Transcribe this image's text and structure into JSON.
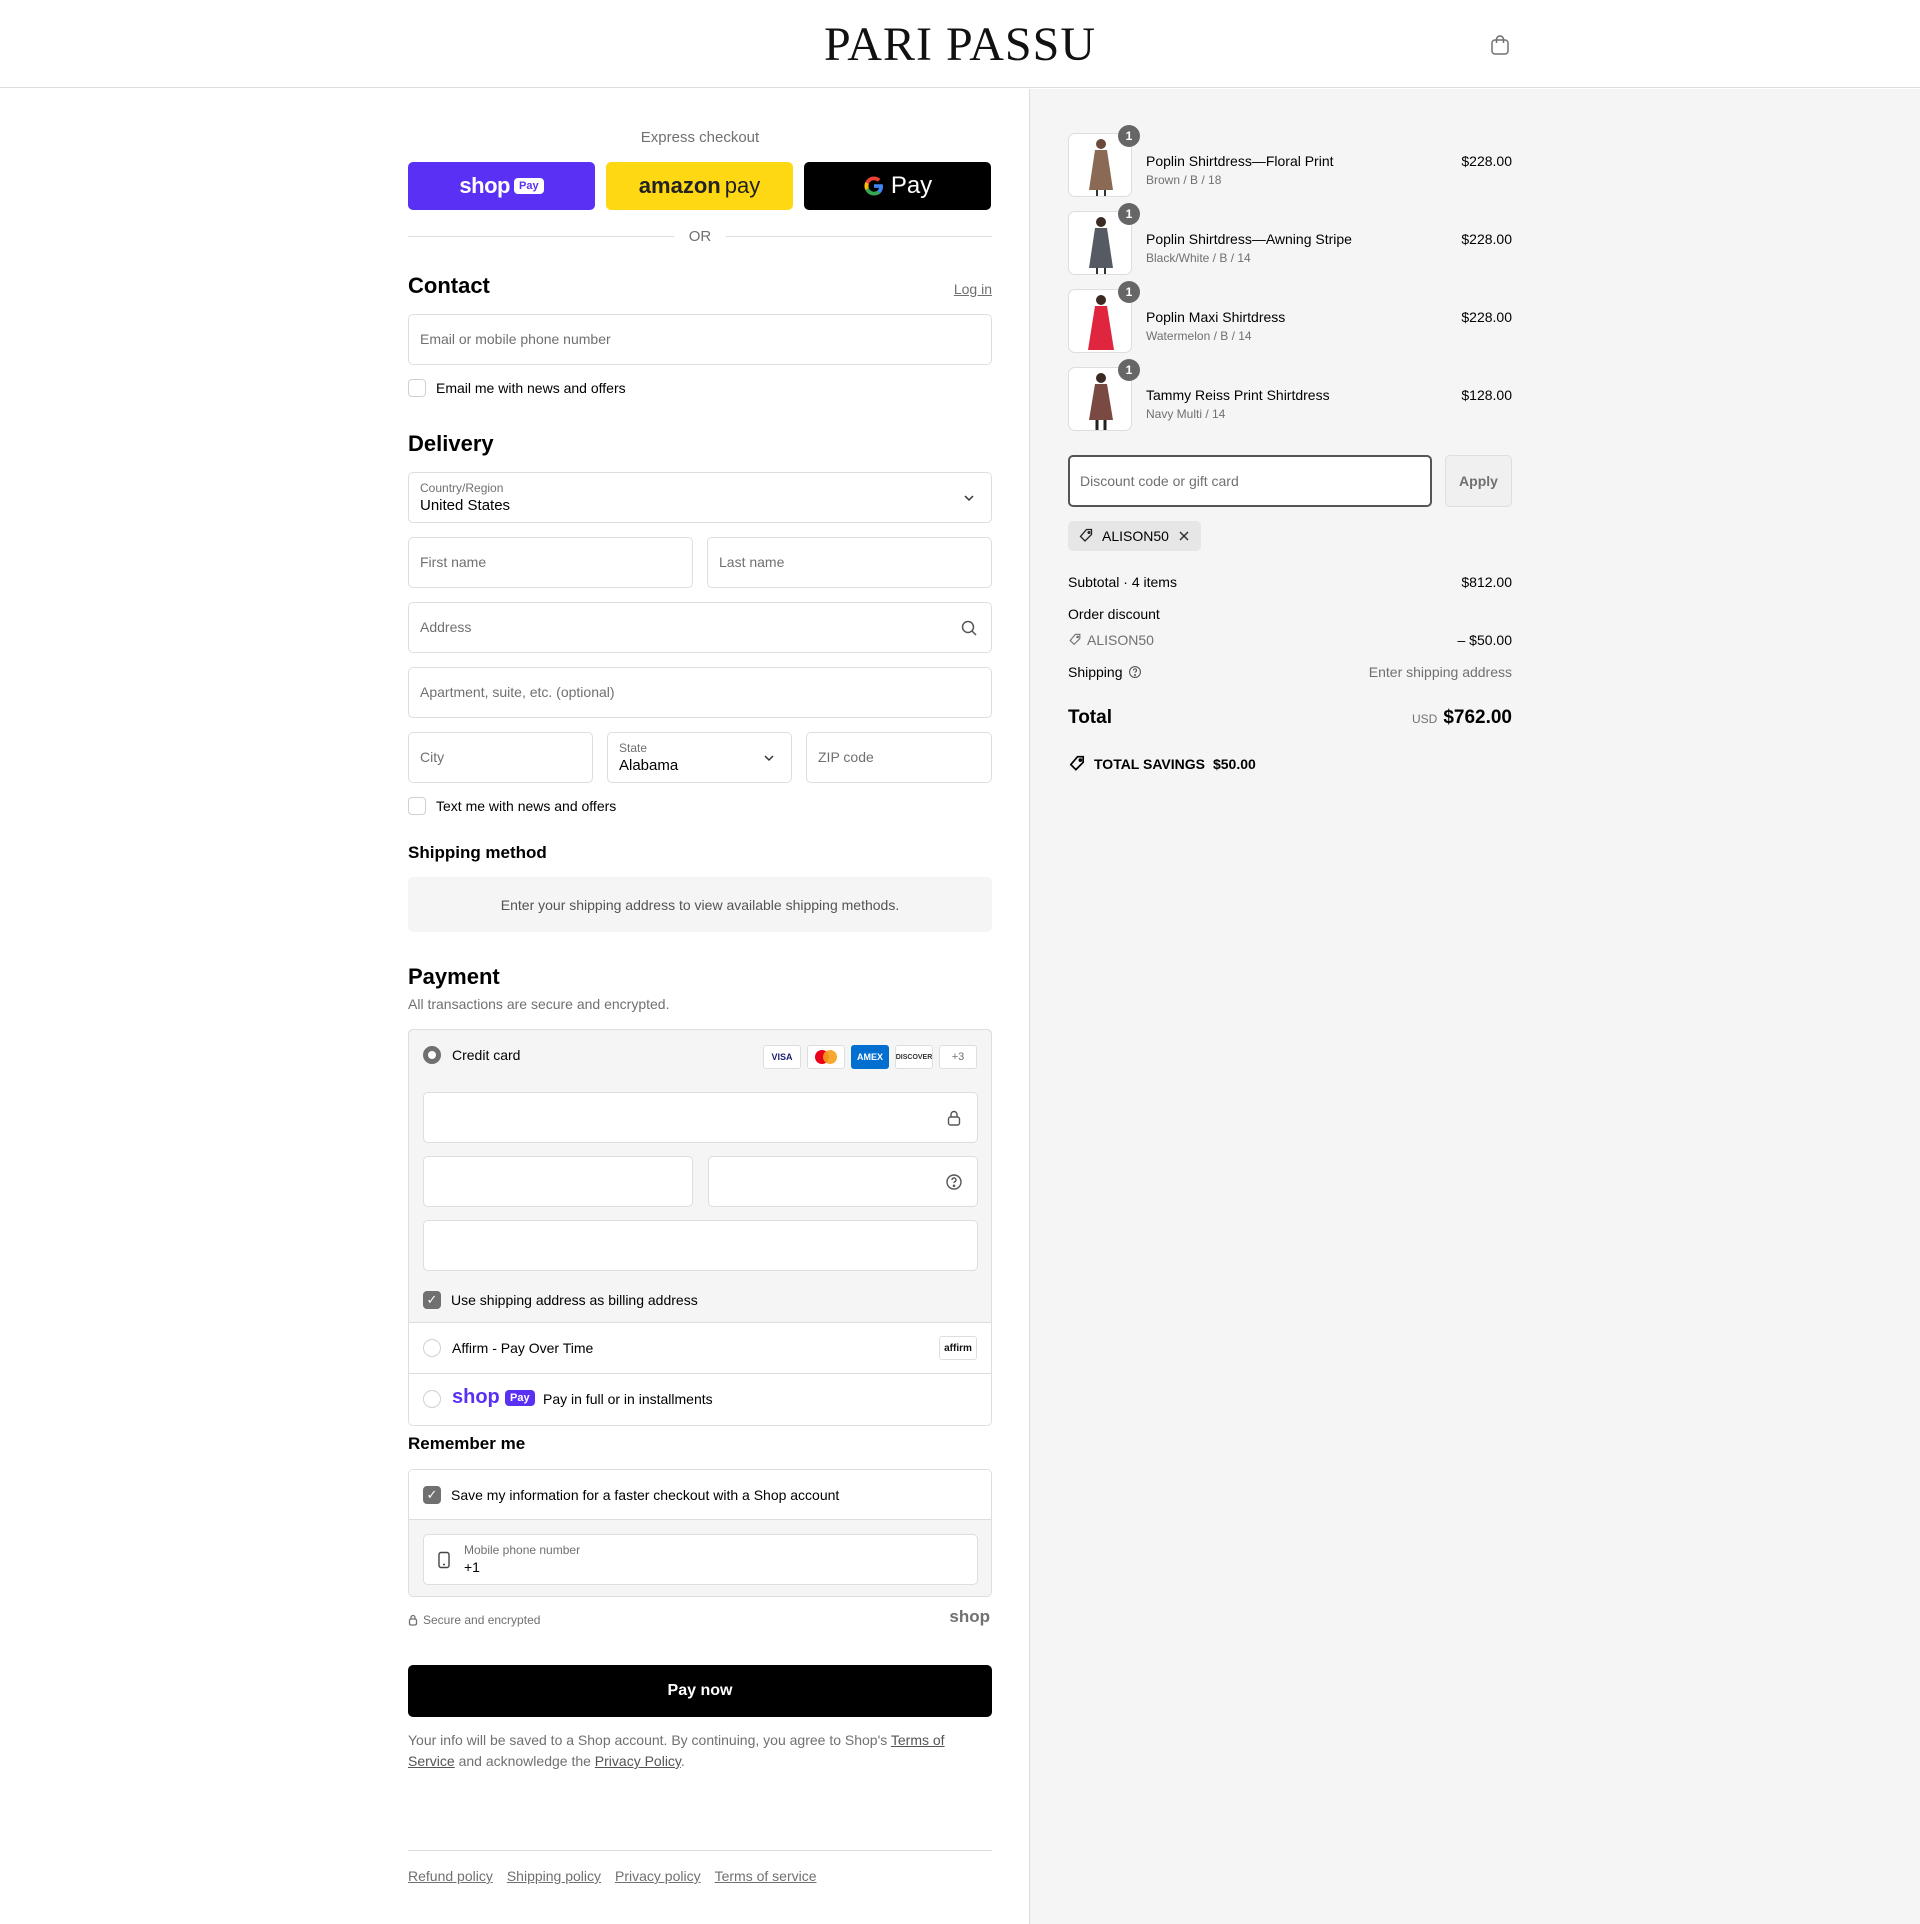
{
  "header": {
    "brand": "PARI PASSU",
    "cart_icon": "shopping-bag-icon"
  },
  "express": {
    "label": "Express checkout",
    "shop_pay": {
      "word": "shop",
      "badge": "Pay"
    },
    "amazon_pay": {
      "word": "amazon",
      "suffix": "pay"
    },
    "google_pay": {
      "word": "Pay"
    },
    "or": "OR"
  },
  "contact": {
    "title": "Contact",
    "login": "Log in",
    "email_placeholder": "Email or mobile phone number",
    "news_label": "Email me with news and offers"
  },
  "delivery": {
    "title": "Delivery",
    "country_label": "Country/Region",
    "country_value": "United States",
    "first_name": "First name",
    "last_name": "Last name",
    "address": "Address",
    "apartment": "Apartment, suite, etc. (optional)",
    "city": "City",
    "state_label": "State",
    "state_value": "Alabama",
    "zip": "ZIP code",
    "text_label": "Text me with news and offers"
  },
  "shipping_method": {
    "title": "Shipping method",
    "message": "Enter your shipping address to view available shipping methods."
  },
  "payment": {
    "title": "Payment",
    "subtitle": "All transactions are secure and encrypted.",
    "credit_card": "Credit card",
    "card_logos": [
      "VISA",
      "MC",
      "AMEX",
      "DISCOVER"
    ],
    "more_cards": "+3",
    "billing_label": "Use shipping address as billing address",
    "affirm_label": "Affirm - Pay Over Time",
    "affirm_logo": "affirm",
    "shop_pay_word": "shop",
    "shop_pay_badge": "Pay",
    "shop_pay_label": "Pay in full or in installments"
  },
  "remember": {
    "title": "Remember me",
    "save_label": "Save my information for a faster checkout with a Shop account",
    "phone_label": "Mobile phone number",
    "phone_value": "+1",
    "secure": "Secure and encrypted",
    "shop_logo": "shop"
  },
  "pay_now": "Pay now",
  "legal": {
    "part1": "Your info will be saved to a Shop account. By continuing, you agree to Shop's ",
    "terms": "Terms of Service",
    "part2": " and acknowledge the ",
    "privacy": "Privacy Policy",
    "part3": "."
  },
  "footer_links": [
    "Refund policy",
    "Shipping policy",
    "Privacy policy",
    "Terms of service"
  ],
  "cart": {
    "items": [
      {
        "qty": "1",
        "name": "Poplin Shirtdress—Floral Print",
        "variant": "Brown / B / 18",
        "price": "$228.00",
        "color": "#8a6a55"
      },
      {
        "qty": "1",
        "name": "Poplin Shirtdress—Awning Stripe",
        "variant": "Black/White / B / 14",
        "price": "$228.00",
        "color": "#555a63"
      },
      {
        "qty": "1",
        "name": "Poplin Maxi Shirtdress",
        "variant": "Watermelon / B / 14",
        "price": "$228.00",
        "color": "#e0263f"
      },
      {
        "qty": "1",
        "name": "Tammy Reiss Print Shirtdress",
        "variant": "Navy Multi / 14",
        "price": "$128.00",
        "color": "#7a4a42"
      }
    ],
    "discount_placeholder": "Discount code or gift card",
    "apply": "Apply",
    "applied_code": "ALISON50",
    "subtotal_label": "Subtotal · 4 items",
    "subtotal_value": "$812.00",
    "order_discount_label": "Order discount",
    "discount_code": "ALISON50",
    "discount_value": "– $50.00",
    "shipping_label": "Shipping",
    "shipping_value": "Enter shipping address",
    "total_label": "Total",
    "currency": "USD",
    "total_value": "$762.00",
    "savings_label": "TOTAL SAVINGS",
    "savings_value": "$50.00"
  }
}
